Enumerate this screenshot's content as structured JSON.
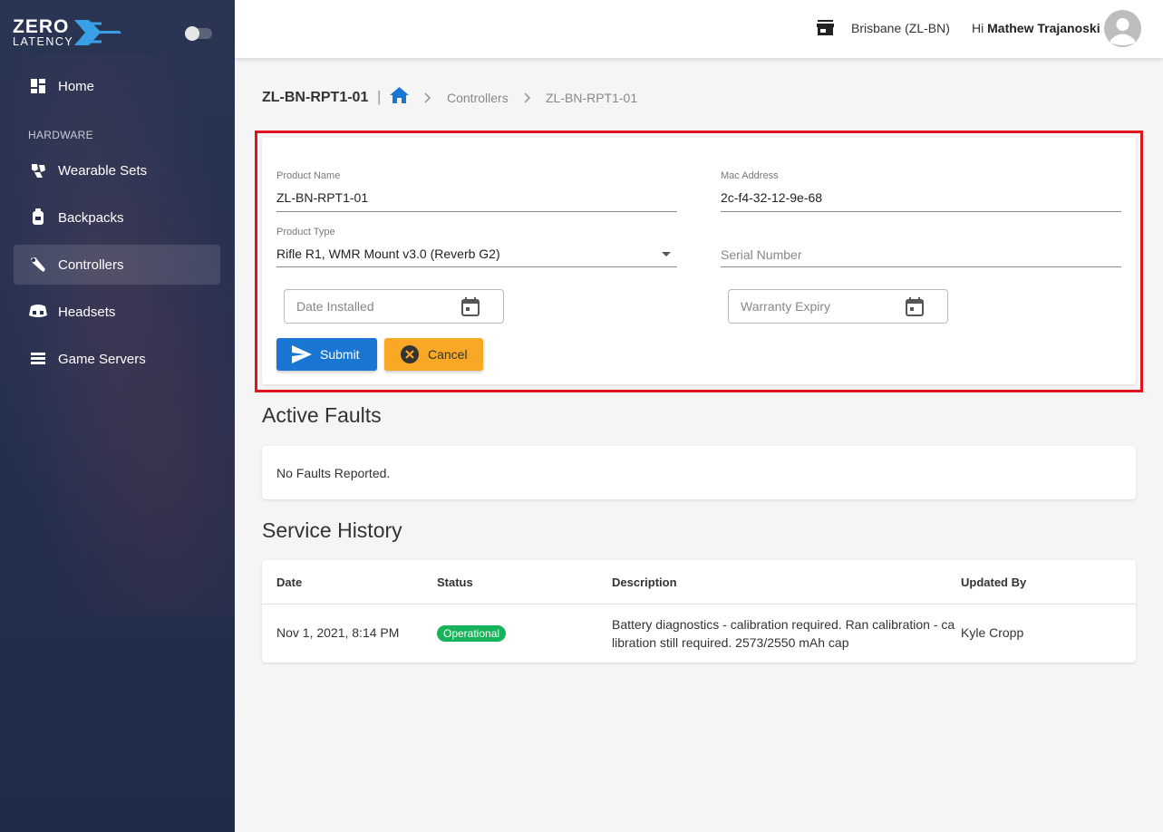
{
  "brand": {
    "line1": "ZERO",
    "line2": "LATENCY"
  },
  "sidebar": {
    "section_hardware": "HARDWARE",
    "items": [
      {
        "label": "Home",
        "icon": "dashboard-icon"
      },
      {
        "label": "Wearable Sets",
        "icon": "wearable-icon"
      },
      {
        "label": "Backpacks",
        "icon": "backpack-icon"
      },
      {
        "label": "Controllers",
        "icon": "controller-icon",
        "active": true
      },
      {
        "label": "Headsets",
        "icon": "headset-icon"
      },
      {
        "label": "Game Servers",
        "icon": "server-icon"
      }
    ]
  },
  "topbar": {
    "location": "Brisbane (ZL-BN)",
    "greeting_prefix": "Hi",
    "user_name": "Mathew Trajanoski"
  },
  "breadcrumb": {
    "title": "ZL-BN-RPT1-01",
    "separator": "|",
    "items": [
      "Controllers",
      "ZL-BN-RPT1-01"
    ]
  },
  "form": {
    "product_name": {
      "label": "Product Name",
      "value": "ZL-BN-RPT1-01"
    },
    "mac_address": {
      "label": "Mac Address",
      "value": "2c-f4-32-12-9e-68"
    },
    "product_type": {
      "label": "Product Type",
      "value": "Rifle R1, WMR Mount v3.0 (Reverb G2)"
    },
    "serial_number": {
      "placeholder": "Serial Number"
    },
    "date_installed": {
      "placeholder": "Date Installed"
    },
    "warranty_expiry": {
      "placeholder": "Warranty Expiry"
    },
    "submit_label": "Submit",
    "cancel_label": "Cancel"
  },
  "faults": {
    "title": "Active Faults",
    "message": "No Faults Reported."
  },
  "history": {
    "title": "Service History",
    "columns": [
      "Date",
      "Status",
      "Description",
      "Updated By"
    ],
    "rows": [
      {
        "date": "Nov 1, 2021, 8:14 PM",
        "status": "Operational",
        "description": "Battery diagnostics - calibration required. Ran calibration - calibration still required. 2573/2550 mAh cap",
        "updated_by": "Kyle Cropp"
      }
    ]
  },
  "colors": {
    "sidebar_bg": "#243052",
    "primary": "#1976d2",
    "warning": "#f9a825",
    "success": "#16b35a",
    "highlight": "#e0141e"
  }
}
